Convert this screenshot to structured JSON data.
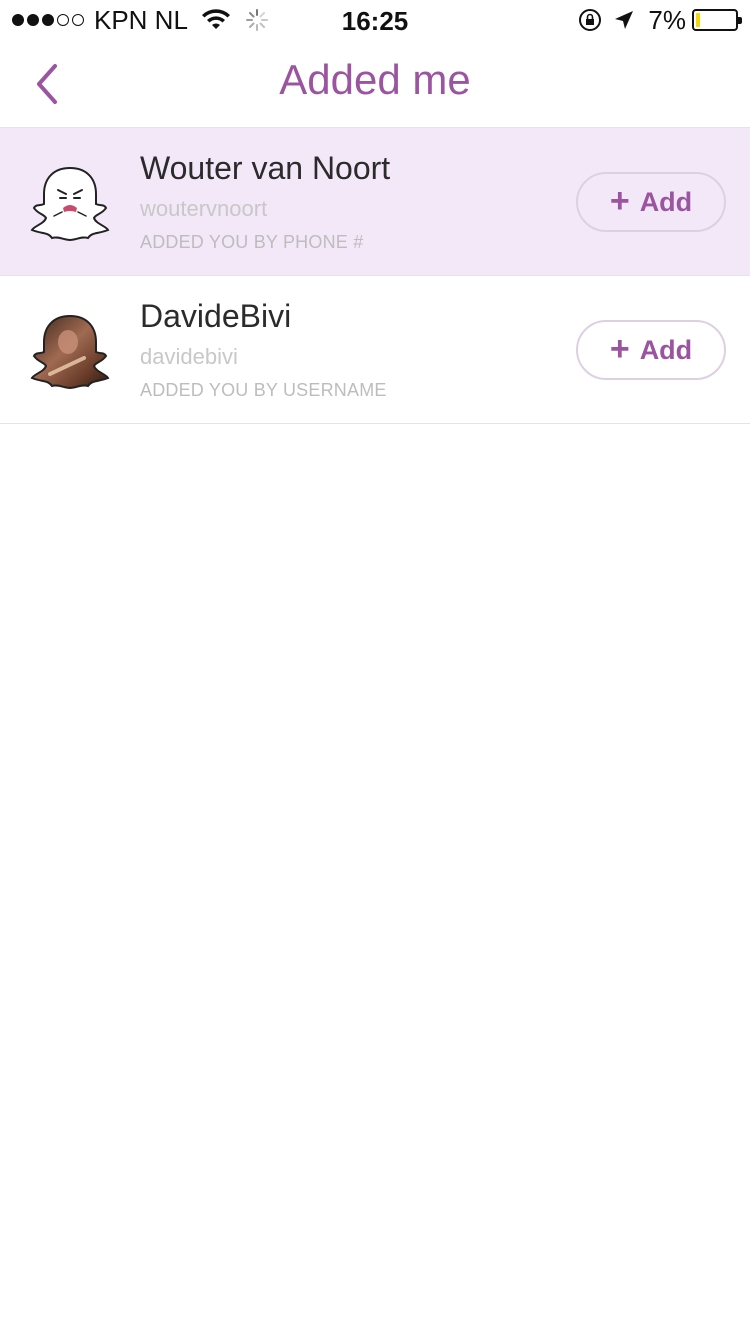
{
  "status_bar": {
    "carrier": "KPN NL",
    "time": "16:25",
    "battery_percent": "7%",
    "battery_level": 0.07,
    "signal_bars_filled": 3,
    "signal_bars_total": 5
  },
  "nav": {
    "title": "Added me",
    "back_icon": "chevron-left-icon"
  },
  "colors": {
    "accent": "#9b55a0",
    "highlight_row": "#f3e8f8"
  },
  "users": [
    {
      "name": "Wouter van Noort",
      "username": "woutervnoort",
      "added_by": "ADDED YOU BY PHONE #",
      "avatar": "ghost-icon",
      "add_label": "Add",
      "highlighted": true
    },
    {
      "name": "DavideBivi",
      "username": "davidebivi",
      "added_by": "ADDED YOU BY USERNAME",
      "avatar": "photo-ghost-icon",
      "add_label": "Add",
      "highlighted": false
    }
  ]
}
